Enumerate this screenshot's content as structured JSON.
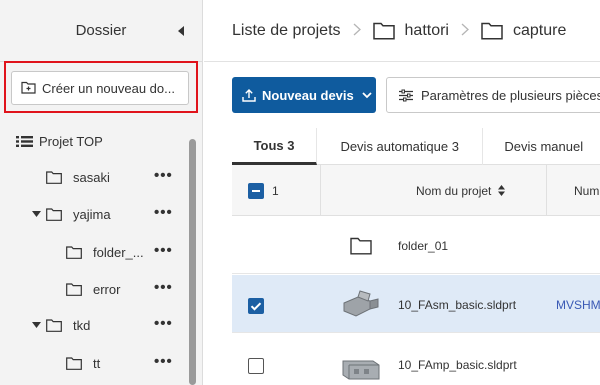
{
  "sidebar": {
    "title": "Dossier",
    "create_label": "Créer un nouveau do...",
    "tree": [
      {
        "label": "Projet TOP",
        "type": "root"
      },
      {
        "label": "sasaki",
        "type": "folder",
        "expanded": false
      },
      {
        "label": "yajima",
        "type": "folder",
        "expanded": true
      },
      {
        "label": "folder_...",
        "type": "folder",
        "expanded": false
      },
      {
        "label": "error",
        "type": "folder",
        "expanded": false
      },
      {
        "label": "tkd",
        "type": "folder",
        "expanded": true
      },
      {
        "label": "tt",
        "type": "folder",
        "expanded": false
      }
    ],
    "more_label": "•••"
  },
  "breadcrumb": {
    "root": "Liste de projets",
    "items": [
      "hattori",
      "capture"
    ]
  },
  "toolbar": {
    "new_quote": "Nouveau devis",
    "multi_params": "Paramètres de plusieurs pièces"
  },
  "tabs": [
    {
      "label": "Tous",
      "count": "3",
      "active": true
    },
    {
      "label": "Devis automatique",
      "count": "3",
      "active": false
    },
    {
      "label": "Devis manuel",
      "count": "",
      "active": false
    }
  ],
  "table": {
    "selected_count": "1",
    "col_project": "Nom du projet",
    "col_num": "Num",
    "rows": [
      {
        "name": "folder_01",
        "kind": "folder",
        "num": "",
        "selected": false
      },
      {
        "name": "10_FAsm_basic.sldprt",
        "kind": "part",
        "num": "MVSHM",
        "selected": true
      },
      {
        "name": "10_FAmp_basic.sldprt",
        "kind": "part",
        "num": "",
        "selected": false
      }
    ]
  },
  "colors": {
    "primary": "#0f5b9e",
    "highlight_box": "#e0131b",
    "selected_row": "#dfeaf7",
    "checkbox": "#1c5fa3"
  }
}
